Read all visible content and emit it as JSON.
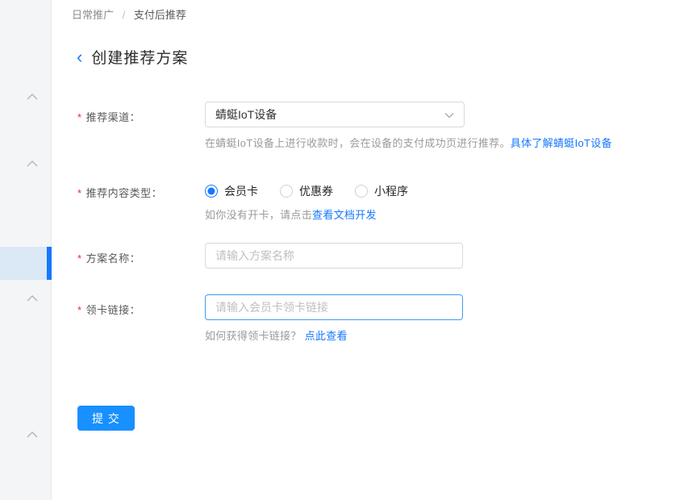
{
  "colors": {
    "accent": "#1677ff",
    "button": "#1890ff",
    "link": "#1677ff",
    "required": "#f5222d",
    "sidebar_bg": "#f4f5f6",
    "sidebar_highlight": "#dbe8f5",
    "sidebar_active_bar": "#1677ff",
    "focused_input_border": "#3f9bf7"
  },
  "breadcrumb": {
    "items": [
      {
        "label": "日常推广"
      },
      {
        "label": "支付后推荐"
      }
    ],
    "separator": "/"
  },
  "page": {
    "back_icon": "‹",
    "title": "创建推荐方案"
  },
  "form": {
    "fields": [
      {
        "label": "推荐渠道：",
        "required": "*",
        "type": "select",
        "value": "蜻蜓IoT设备",
        "helper": {
          "text": "在蜻蜓IoT设备上进行收款时，会在设备的支付成功页进行推荐。",
          "link": "具体了解蜻蜓IoT设备"
        }
      },
      {
        "label": "推荐内容类型：",
        "required": "*",
        "type": "radio-group",
        "options": [
          "会员卡",
          "优惠券",
          "小程序"
        ],
        "selected": "会员卡",
        "helper": {
          "text": "如你没有开卡，请点击",
          "link": "查看文档开发"
        }
      },
      {
        "label": "方案名称：",
        "required": "*",
        "type": "input",
        "value": "",
        "placeholder": "请输入方案名称"
      },
      {
        "label": "领卡链接：",
        "required": "*",
        "type": "input",
        "value": "",
        "placeholder": "请输入会员卡领卡链接",
        "focused": true,
        "helper": {
          "text": "如何获得领卡链接？",
          "link": "点此查看"
        }
      }
    ],
    "submit_label": "提 交"
  }
}
